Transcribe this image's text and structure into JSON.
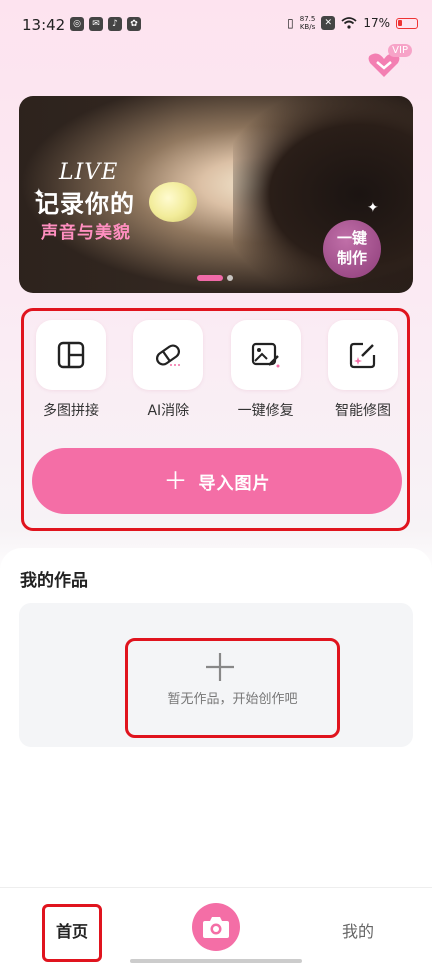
{
  "status_bar": {
    "time": "13:42",
    "net_speed_value": "87.5",
    "net_speed_unit": "KB/s",
    "battery_percent": "17%"
  },
  "vip": {
    "label": "VIP"
  },
  "banner": {
    "live_text": "LIVE",
    "title": "记录你的",
    "subtitle": "声音与美貌",
    "cta_line1": "一键",
    "cta_line2": "制作",
    "page_index": 0
  },
  "tools": [
    {
      "label": "多图拼接",
      "icon": "collage-icon"
    },
    {
      "label": "AI消除",
      "icon": "eraser-icon"
    },
    {
      "label": "一键修复",
      "icon": "image-repair-icon"
    },
    {
      "label": "智能修图",
      "icon": "smart-edit-icon"
    }
  ],
  "import_button": {
    "label": "导入图片"
  },
  "works": {
    "title": "我的作品",
    "empty_text": "暂无作品，开始创作吧"
  },
  "bottom_nav": {
    "home": "首页",
    "mine": "我的"
  },
  "colors": {
    "accent": "#f46ea6",
    "highlight_border": "#e0141e"
  }
}
